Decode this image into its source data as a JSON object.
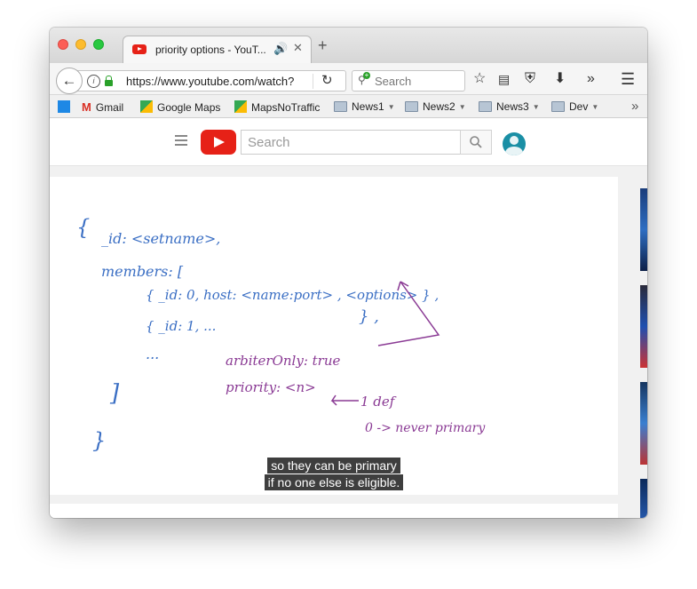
{
  "tab": {
    "title": "priority options - YouT..."
  },
  "nav": {
    "url": "https://www.youtube.com/watch?",
    "search_placeholder": "Search"
  },
  "bookmarks": [
    {
      "label": "Gmail"
    },
    {
      "label": "Google Maps"
    },
    {
      "label": "MapsNoTraffic"
    },
    {
      "label": "News1"
    },
    {
      "label": "News2"
    },
    {
      "label": "News3"
    },
    {
      "label": "Dev"
    }
  ],
  "youtube": {
    "search_placeholder": "Search"
  },
  "whiteboard": {
    "lines": [
      "{",
      "_id: <setname>,",
      "members: [",
      "{ _id: 0, host: <name:port> , <options> } ,",
      "{ _id: 1, ...",
      "} ,",
      "...",
      "]",
      "}",
      "arbiterOnly: true",
      "priority: <n>",
      "1 def",
      "0 -> never primary"
    ]
  },
  "captions": {
    "line1": "so they can be primary",
    "line2": "if no one else is eligible."
  },
  "colors": {
    "ink_blue": "#3b6fc4",
    "ink_purple": "#8a3a94",
    "youtube_red": "#e62117"
  }
}
